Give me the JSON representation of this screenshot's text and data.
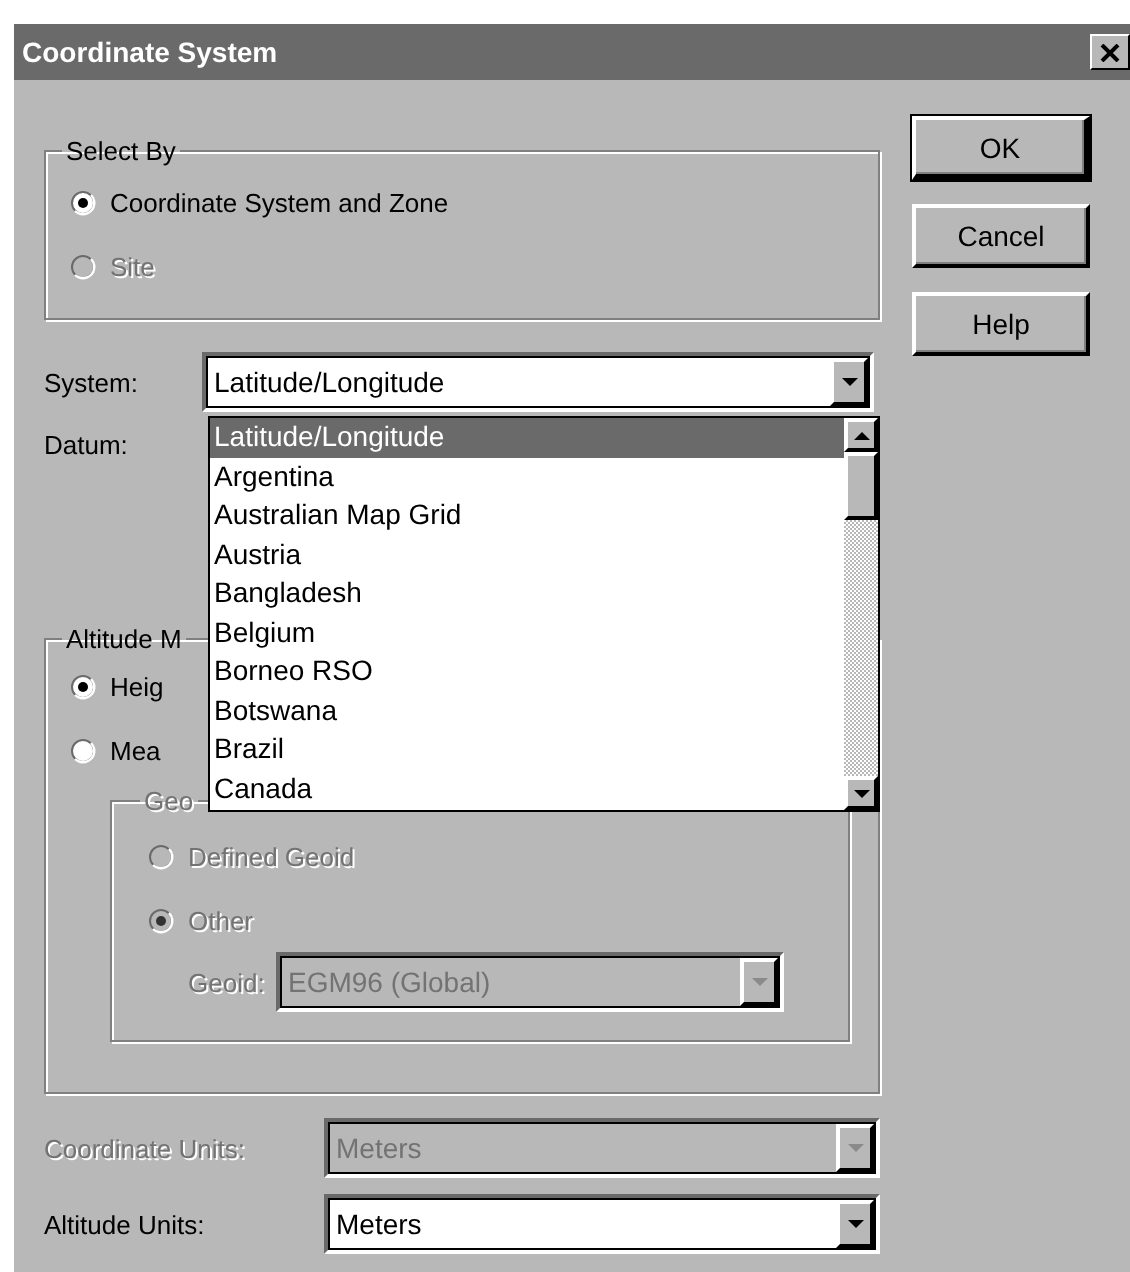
{
  "window": {
    "title": "Coordinate System"
  },
  "select_by": {
    "label": "Select By",
    "options": [
      {
        "label": "Coordinate System and Zone",
        "selected": true,
        "disabled": false
      },
      {
        "label": "Site",
        "selected": false,
        "disabled": true
      }
    ]
  },
  "buttons": [
    {
      "label": "OK",
      "default": true
    },
    {
      "label": "Cancel",
      "default": false
    },
    {
      "label": "Help",
      "default": false
    }
  ],
  "system": {
    "label": "System:",
    "value": "Latitude/Longitude",
    "expanded": true,
    "options": [
      {
        "label": "Latitude/Longitude",
        "selected": true
      },
      {
        "label": "Argentina",
        "selected": false
      },
      {
        "label": "Australian Map Grid",
        "selected": false
      },
      {
        "label": "Austria",
        "selected": false
      },
      {
        "label": "Bangladesh",
        "selected": false
      },
      {
        "label": "Belgium",
        "selected": false
      },
      {
        "label": "Borneo RSO",
        "selected": false
      },
      {
        "label": "Botswana",
        "selected": false
      },
      {
        "label": "Brazil",
        "selected": false
      },
      {
        "label": "Canada",
        "selected": false
      }
    ]
  },
  "datum": {
    "label": "Datum:"
  },
  "altitude_mode": {
    "label": "Altitude M",
    "options": [
      {
        "label": "Heig",
        "selected": true,
        "disabled": false
      },
      {
        "label": "Mea",
        "selected": false,
        "disabled": false
      }
    ],
    "geoid_group": {
      "label": "Geo",
      "disabled": true,
      "options": [
        {
          "label": "Defined Geoid",
          "selected": false,
          "disabled": true
        },
        {
          "label": "Other",
          "selected": true,
          "disabled": true
        }
      ],
      "geoid": {
        "label": "Geoid:",
        "value": "EGM96 (Global)",
        "disabled": true
      }
    }
  },
  "coordinate_units": {
    "label": "Coordinate Units:",
    "value": "Meters",
    "disabled": true
  },
  "altitude_units": {
    "label": "Altitude Units:",
    "value": "Meters",
    "disabled": false
  }
}
